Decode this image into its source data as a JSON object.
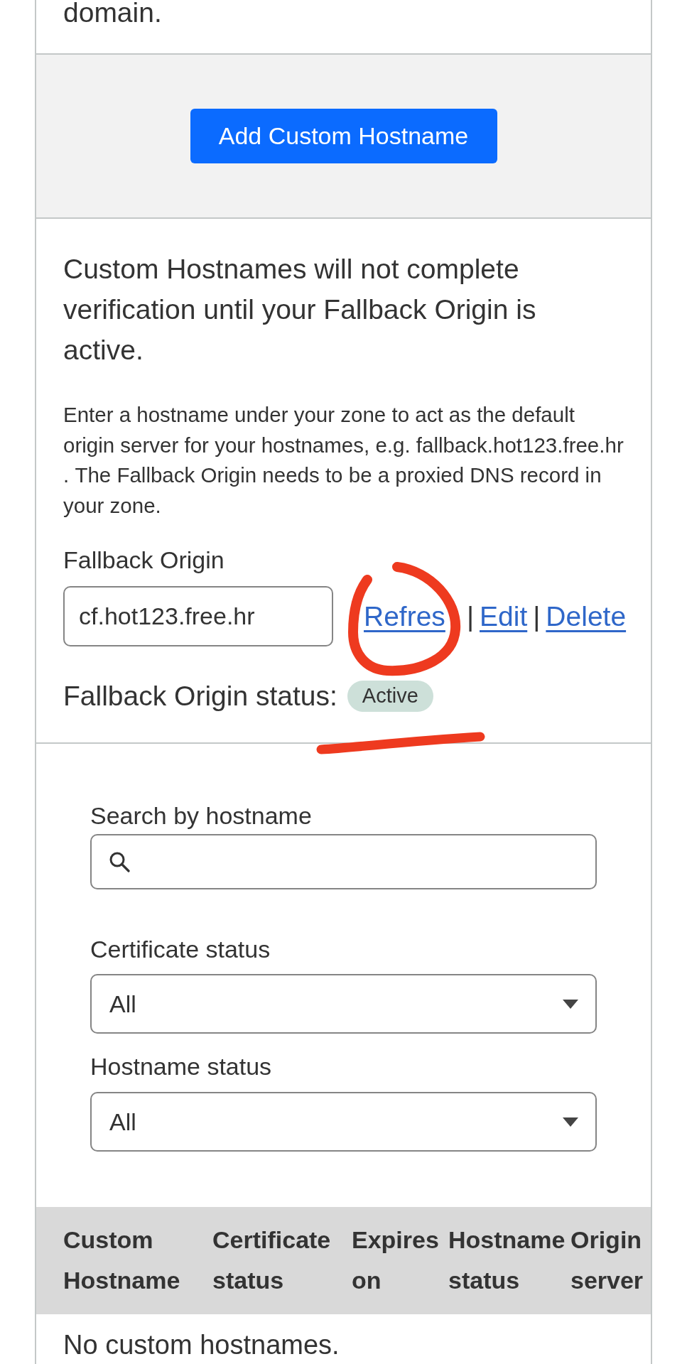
{
  "intro": {
    "text": "domain."
  },
  "actions": {
    "button": "Add Custom Hostname"
  },
  "fallback": {
    "notice": "Custom Hostnames will not complete verification until your Fallback Origin is active.",
    "description": "Enter a hostname under your zone to act as the default origin server for your hostnames, e.g. fallback.hot123.free.hr . The Fallback Origin needs to be a proxied DNS record in your zone.",
    "field_label": "Fallback Origin",
    "value": "cf.hot123.free.hr",
    "links": [
      {
        "label": "Refres"
      },
      {
        "separator": "|",
        "label": "Edit"
      },
      {
        "separator": "|",
        "label": "Delete"
      }
    ],
    "status_label": "Fallback Origin status:",
    "status": "Active"
  },
  "filters": {
    "search": {
      "label": "Search by hostname"
    },
    "selects": [
      {
        "label": "Certificate status",
        "value": "All"
      },
      {
        "label": "Hostname status",
        "value": "All"
      }
    ]
  },
  "table": {
    "columns": [
      "Custom Hostname",
      "Certificate status",
      "Expires on",
      "Hostname status",
      "Origin server"
    ],
    "empty_message": "No custom hostnames."
  }
}
